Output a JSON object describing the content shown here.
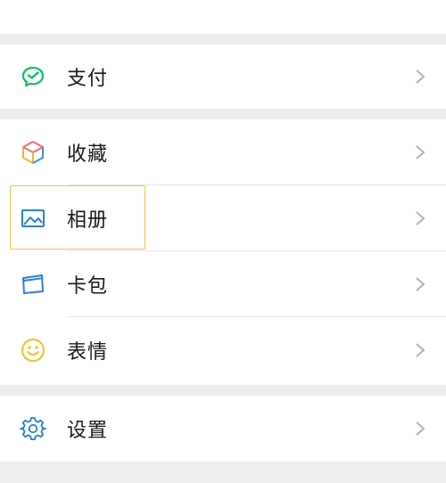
{
  "menu": {
    "pay": {
      "label": "支付",
      "icon": "wechat-pay-icon"
    },
    "favorites": {
      "label": "收藏",
      "icon": "cube-icon"
    },
    "album": {
      "label": "相册",
      "icon": "picture-icon"
    },
    "cards": {
      "label": "卡包",
      "icon": "card-icon"
    },
    "stickers": {
      "label": "表情",
      "icon": "smiley-icon"
    },
    "settings": {
      "label": "设置",
      "icon": "gear-icon"
    }
  },
  "colors": {
    "background": "#ededed",
    "pay_green": "#07c160",
    "album_blue": "#2b7fd8",
    "smiley_yellow": "#f5c232",
    "highlight": "#f3c343",
    "chevron": "#b2b2b2"
  }
}
